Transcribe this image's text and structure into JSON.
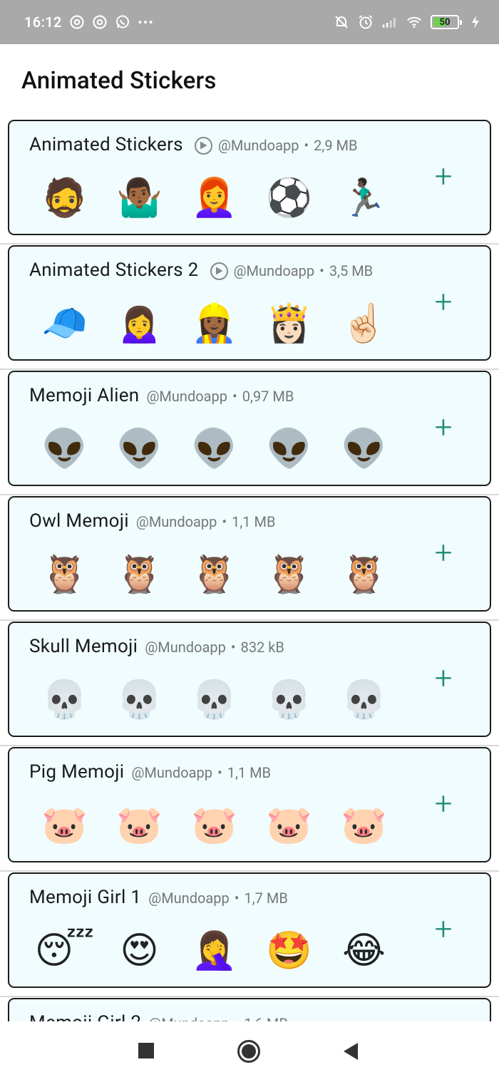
{
  "status_bar": {
    "time": "16:12",
    "battery_level": "50",
    "icons_left": [
      "at-sign-icon",
      "at-sign-icon",
      "whatsapp-icon",
      "more-dots-icon"
    ],
    "icons_right": [
      "mute-icon",
      "alarm-icon",
      "signal-icon",
      "wifi-icon",
      "battery-icon",
      "charging-icon"
    ]
  },
  "header": {
    "title": "Animated Stickers"
  },
  "packs": [
    {
      "name": "Animated Stickers",
      "animated": true,
      "author": "@Mundoapp",
      "separator": "•",
      "size": "2,9 MB",
      "stickers": [
        "🧔",
        "🤷🏾‍♂️",
        "👩‍🦰",
        "⚽",
        "🏃🏿‍♂️"
      ],
      "add_label": "+"
    },
    {
      "name": "Animated Stickers 2",
      "animated": true,
      "author": "@Mundoapp",
      "separator": "•",
      "size": "3,5 MB",
      "stickers": [
        "🧢",
        "🙍‍♀️",
        "👷🏾‍♀️",
        "👸🏻",
        "☝🏻"
      ],
      "add_label": "+"
    },
    {
      "name": "Memoji Alien",
      "animated": false,
      "author": "@Mundoapp",
      "separator": "•",
      "size": "0,97 MB",
      "stickers": [
        "👽",
        "👽",
        "👽",
        "👽",
        "👽"
      ],
      "add_label": "+"
    },
    {
      "name": "Owl Memoji",
      "animated": false,
      "author": "@Mundoapp",
      "separator": "•",
      "size": "1,1 MB",
      "stickers": [
        "🦉",
        "🦉",
        "🦉",
        "🦉",
        "🦉"
      ],
      "add_label": "+"
    },
    {
      "name": "Skull Memoji",
      "animated": false,
      "author": "@Mundoapp",
      "separator": "•",
      "size": "832 kB",
      "stickers": [
        "💀",
        "💀",
        "💀",
        "💀",
        "💀"
      ],
      "add_label": "+"
    },
    {
      "name": "Pig Memoji",
      "animated": false,
      "author": "@Mundoapp",
      "separator": "•",
      "size": "1,1 MB",
      "stickers": [
        "🐷",
        "🐷",
        "🐷",
        "🐷",
        "🐷"
      ],
      "add_label": "+"
    },
    {
      "name": "Memoji Girl 1",
      "animated": false,
      "author": "@Mundoapp",
      "separator": "•",
      "size": "1,7 MB",
      "stickers": [
        "😴",
        "😍",
        "🤦‍♀️",
        "🤩",
        "😂"
      ],
      "add_label": "+"
    },
    {
      "name": "Memoji Girl 2",
      "animated": false,
      "author": "@Mundoapp",
      "separator": "•",
      "size": "1,6 MB",
      "stickers": [
        "🙂",
        "🙂",
        "🙂",
        "🙂",
        "🙂"
      ],
      "add_label": "+"
    }
  ],
  "nav_bar": {
    "buttons": [
      "recents-button",
      "home-button",
      "back-button"
    ]
  }
}
